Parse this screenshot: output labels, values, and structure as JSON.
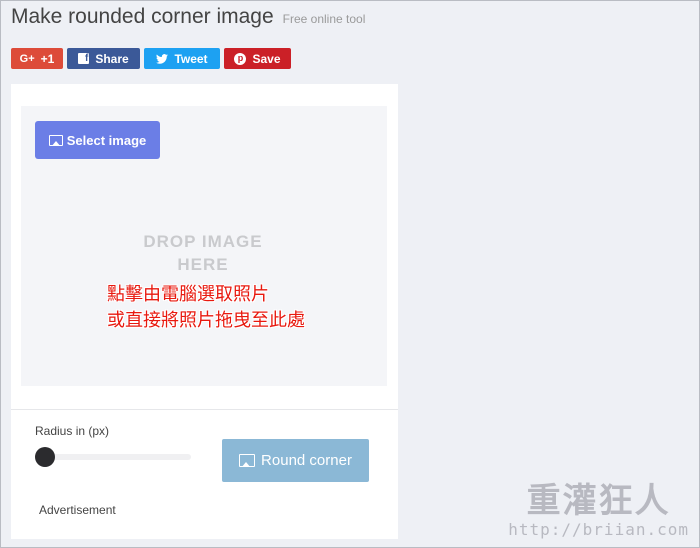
{
  "header": {
    "title": "Make rounded corner image",
    "subtitle": "Free online tool"
  },
  "share": {
    "gplus_label": "+1",
    "gplus_icon_text": "G+",
    "facebook_label": "Share",
    "twitter_label": "Tweet",
    "pinterest_label": "Save",
    "colors": {
      "gplus": "#dd4b39",
      "facebook": "#3b5998",
      "twitter": "#1da1f2",
      "pinterest": "#cb2027"
    }
  },
  "dropzone": {
    "select_label": "Select image",
    "drop_text": "DROP IMAGE\nHERE",
    "annotation_line1": "點擊由電腦選取照片",
    "annotation_line2": "或直接將照片拖曳至此處"
  },
  "controls": {
    "radius_label": "Radius in (px)",
    "radius_value_fraction": 0,
    "round_label": "Round corner",
    "advertisement_label": "Advertisement"
  },
  "watermark": {
    "main": "重灌狂人",
    "url": "http://briian.com"
  },
  "icons": {
    "select": "image-icon",
    "round": "image-icon",
    "facebook": "facebook-icon",
    "twitter": "twitter-icon",
    "pinterest": "pinterest-icon"
  },
  "colors": {
    "select_button": "#6b7ee6",
    "round_button": "#8bb8d6",
    "annotation": "#e8190f",
    "background": "#eef0f5"
  }
}
